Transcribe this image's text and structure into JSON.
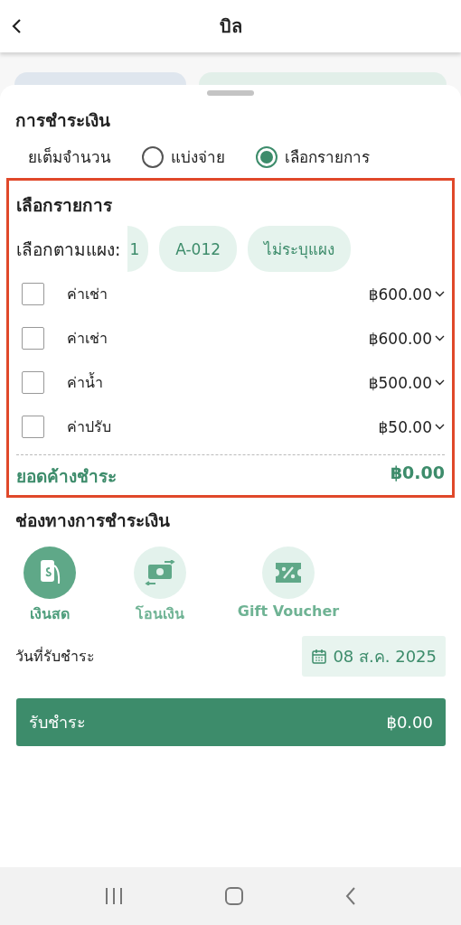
{
  "header": {
    "title": "บิล"
  },
  "payment": {
    "title": "การชำระเงิน",
    "options": [
      {
        "kind": "label",
        "label": "ยเต็มจำนวน",
        "selected": false
      },
      {
        "kind": "radio",
        "label": "แบ่งจ่าย",
        "selected": false
      },
      {
        "kind": "radio",
        "label": "เลือกรายการ",
        "selected": true
      }
    ]
  },
  "select_items": {
    "title": "เลือกรายการ",
    "filter_label": "เลือกตามแผง:",
    "chips": [
      {
        "label": "1",
        "selected": false
      },
      {
        "label": "A-012",
        "selected": false
      },
      {
        "label": "ไม่ระบุแผง",
        "selected": false
      }
    ],
    "items": [
      {
        "label": "ค่าเช่า",
        "amount": "฿600.00",
        "checked": false
      },
      {
        "label": "ค่าเช่า",
        "amount": "฿600.00",
        "checked": false
      },
      {
        "label": "ค่าน้ำ",
        "amount": "฿500.00",
        "checked": false
      },
      {
        "label": "ค่าปรับ",
        "amount": "฿50.00",
        "checked": false
      }
    ],
    "total_label": "ยอดค้างชำระ",
    "total_value": "฿0.00"
  },
  "channels": {
    "title": "ช่องทางการชำระเงิน",
    "methods": [
      {
        "kind": "cash",
        "label": "เงินสด",
        "selected": true
      },
      {
        "kind": "transfer",
        "label": "โอนเงิน",
        "selected": false
      },
      {
        "kind": "voucher",
        "label": "Gift Voucher",
        "selected": false
      }
    ]
  },
  "date": {
    "label": "วันที่รับชำระ",
    "value": "08 ส.ค. 2025"
  },
  "pay_button": {
    "label": "รับชำระ",
    "amount": "฿0.00"
  }
}
